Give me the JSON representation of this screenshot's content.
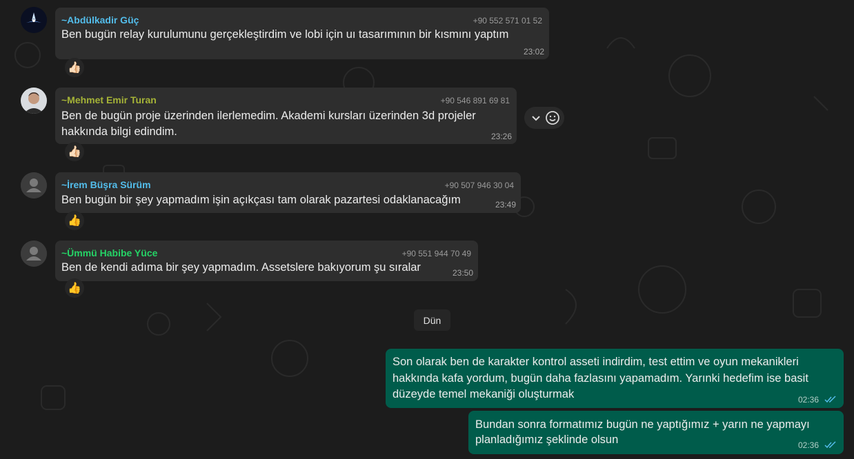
{
  "messages_in": [
    {
      "sender": "~Abdülkadir Güç",
      "sender_color": "#53bdeb",
      "phone": "+90 552 571 01 52",
      "text": "Ben bugün relay kurulumunu gerçekleştirdim ve lobi için uı tasarımının bir kısmını yaptım",
      "time": "23:02",
      "reaction": "👍🏻",
      "avatar": "logo-avatar"
    },
    {
      "sender": "~Mehmet Emir Turan",
      "sender_color": "#a5b337",
      "phone": "+90 546 891 69 81",
      "text_lines": [
        "Ben de bugün proje üzerinden ilerlemedim. Akademi kursları üzerinden 3d projeler",
        "hakkında bilgi edindim."
      ],
      "time": "23:26",
      "reaction": "👍🏻",
      "avatar": "photo-avatar"
    },
    {
      "sender": "~İrem Büşra Sürüm",
      "sender_color": "#53bdeb",
      "phone": "+90 507 946 30 04",
      "text": "Ben bugün bir şey yapmadım işin açıkçası tam olarak pazartesi odaklanacağım",
      "time": "23:49",
      "reaction": "👍",
      "avatar": "default-avatar"
    },
    {
      "sender": "~Ümmü Habibe Yüce",
      "sender_color": "#25d366",
      "phone": "+90 551 944 70 49",
      "text": "Ben de kendi adıma bir şey yapmadım. Assetslere bakıyorum şu sıralar",
      "time": "23:50",
      "reaction": "👍",
      "avatar": "default-avatar"
    }
  ],
  "date_divider": "Dün",
  "messages_out": [
    {
      "text_lines": [
        "Son olarak ben de karakter kontrol asseti indirdim, test ettim ve oyun mekanikleri",
        "hakkında kafa yordum, bugün daha fazlasını yapamadım. Yarınki hedefim ise basit",
        "düzeyde temel mekaniği oluşturmak"
      ],
      "time": "02:36",
      "status": "read-ticks-icon"
    },
    {
      "text_lines": [
        "Bundan sonra formatımız bugün ne yaptığımız + yarın ne yapmayı",
        "planladığımız şeklinde olsun"
      ],
      "time": "02:36",
      "status": "read-ticks-icon"
    }
  ],
  "hover_controls": {
    "icons": [
      "chevron-down-icon",
      "emoji-icon"
    ]
  },
  "colors": {
    "background": "#1c1c1c",
    "incoming_bubble": "#2e2e2e",
    "outgoing_bubble": "#005c4b",
    "read_ticks": "#53bdeb"
  }
}
